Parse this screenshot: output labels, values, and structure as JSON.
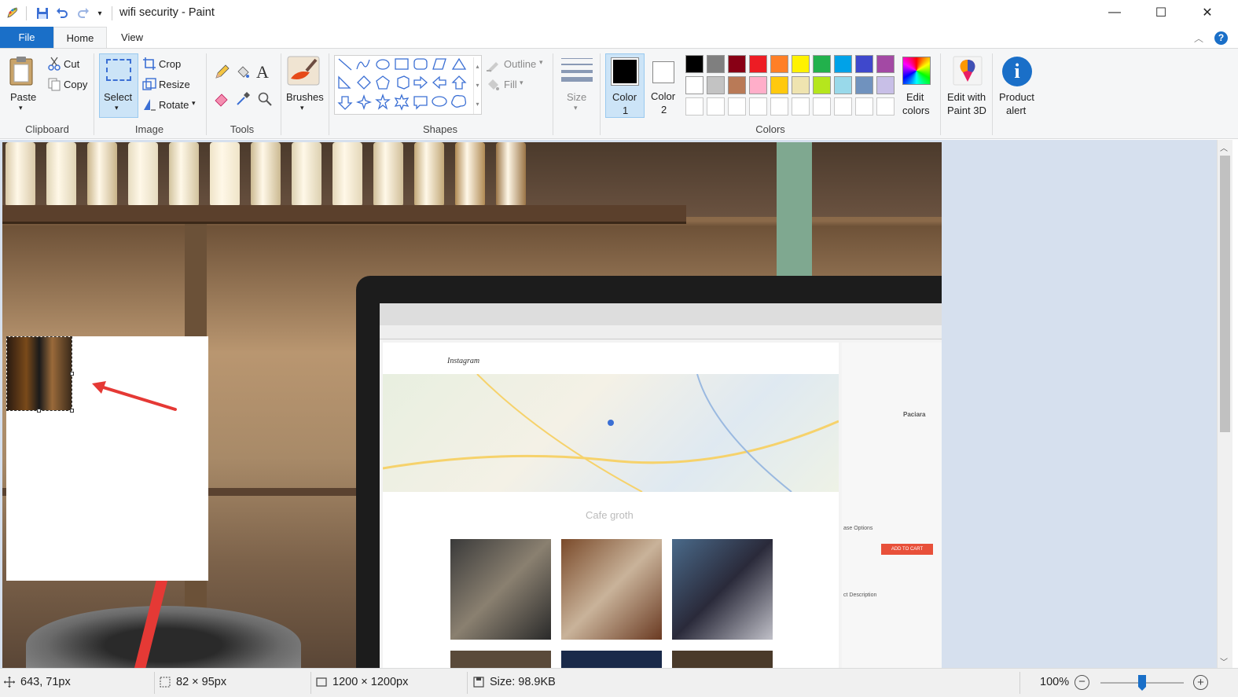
{
  "window": {
    "title": "wifi security - Paint",
    "controls": {
      "minimize": "—",
      "maximize": "☐",
      "close": "✕"
    }
  },
  "tabs": [
    {
      "label": "File"
    },
    {
      "label": "Home"
    },
    {
      "label": "View"
    }
  ],
  "ribbon": {
    "clipboard": {
      "paste": "Paste",
      "cut": "Cut",
      "copy": "Copy",
      "group": "Clipboard"
    },
    "image": {
      "select": "Select",
      "crop": "Crop",
      "resize": "Resize",
      "rotate": "Rotate",
      "group": "Image"
    },
    "tools": {
      "group": "Tools"
    },
    "brushes": {
      "label": "Brushes"
    },
    "shapes": {
      "outline": "Outline",
      "fill": "Fill",
      "group": "Shapes"
    },
    "size": {
      "label": "Size"
    },
    "color1": {
      "label1": "Color",
      "label2": "1"
    },
    "color2": {
      "label1": "Color",
      "label2": "2"
    },
    "colors_group": "Colors",
    "edit_colors": {
      "label1": "Edit",
      "label2": "colors"
    },
    "paint3d": {
      "label1": "Edit with",
      "label2": "Paint 3D"
    },
    "product_alert": {
      "label1": "Product",
      "label2": "alert"
    }
  },
  "palette": {
    "row1": [
      "#000000",
      "#7f7f7f",
      "#880015",
      "#ed1c24",
      "#ff7f27",
      "#fff200",
      "#22b14c",
      "#00a2e8",
      "#3f48cc",
      "#a349a4"
    ],
    "row2": [
      "#ffffff",
      "#c3c3c3",
      "#b97a57",
      "#ffaec9",
      "#ffc90e",
      "#efe4b0",
      "#b5e61d",
      "#99d9ea",
      "#7092be",
      "#c8bfe7"
    ],
    "row3_empty_count": 10
  },
  "canvas": {
    "laptop_screen": {
      "brand": "Instagram",
      "caption": "Cafe groth",
      "side_title": "Paciara",
      "side_buttons": [
        "ADD TO CART"
      ],
      "side_headings": [
        "ase Options",
        "ct Description"
      ]
    }
  },
  "status": {
    "cursor_pos": "643, 71px",
    "selection_size": "82 × 95px",
    "image_size": "1200 × 1200px",
    "file_size": "Size: 98.9KB",
    "zoom": "100%",
    "zoom_fraction": 0.5
  },
  "colors": {
    "accent": "#1a6fc8",
    "selected_bg": "#cce4f7",
    "arrow_red": "#e53935"
  }
}
